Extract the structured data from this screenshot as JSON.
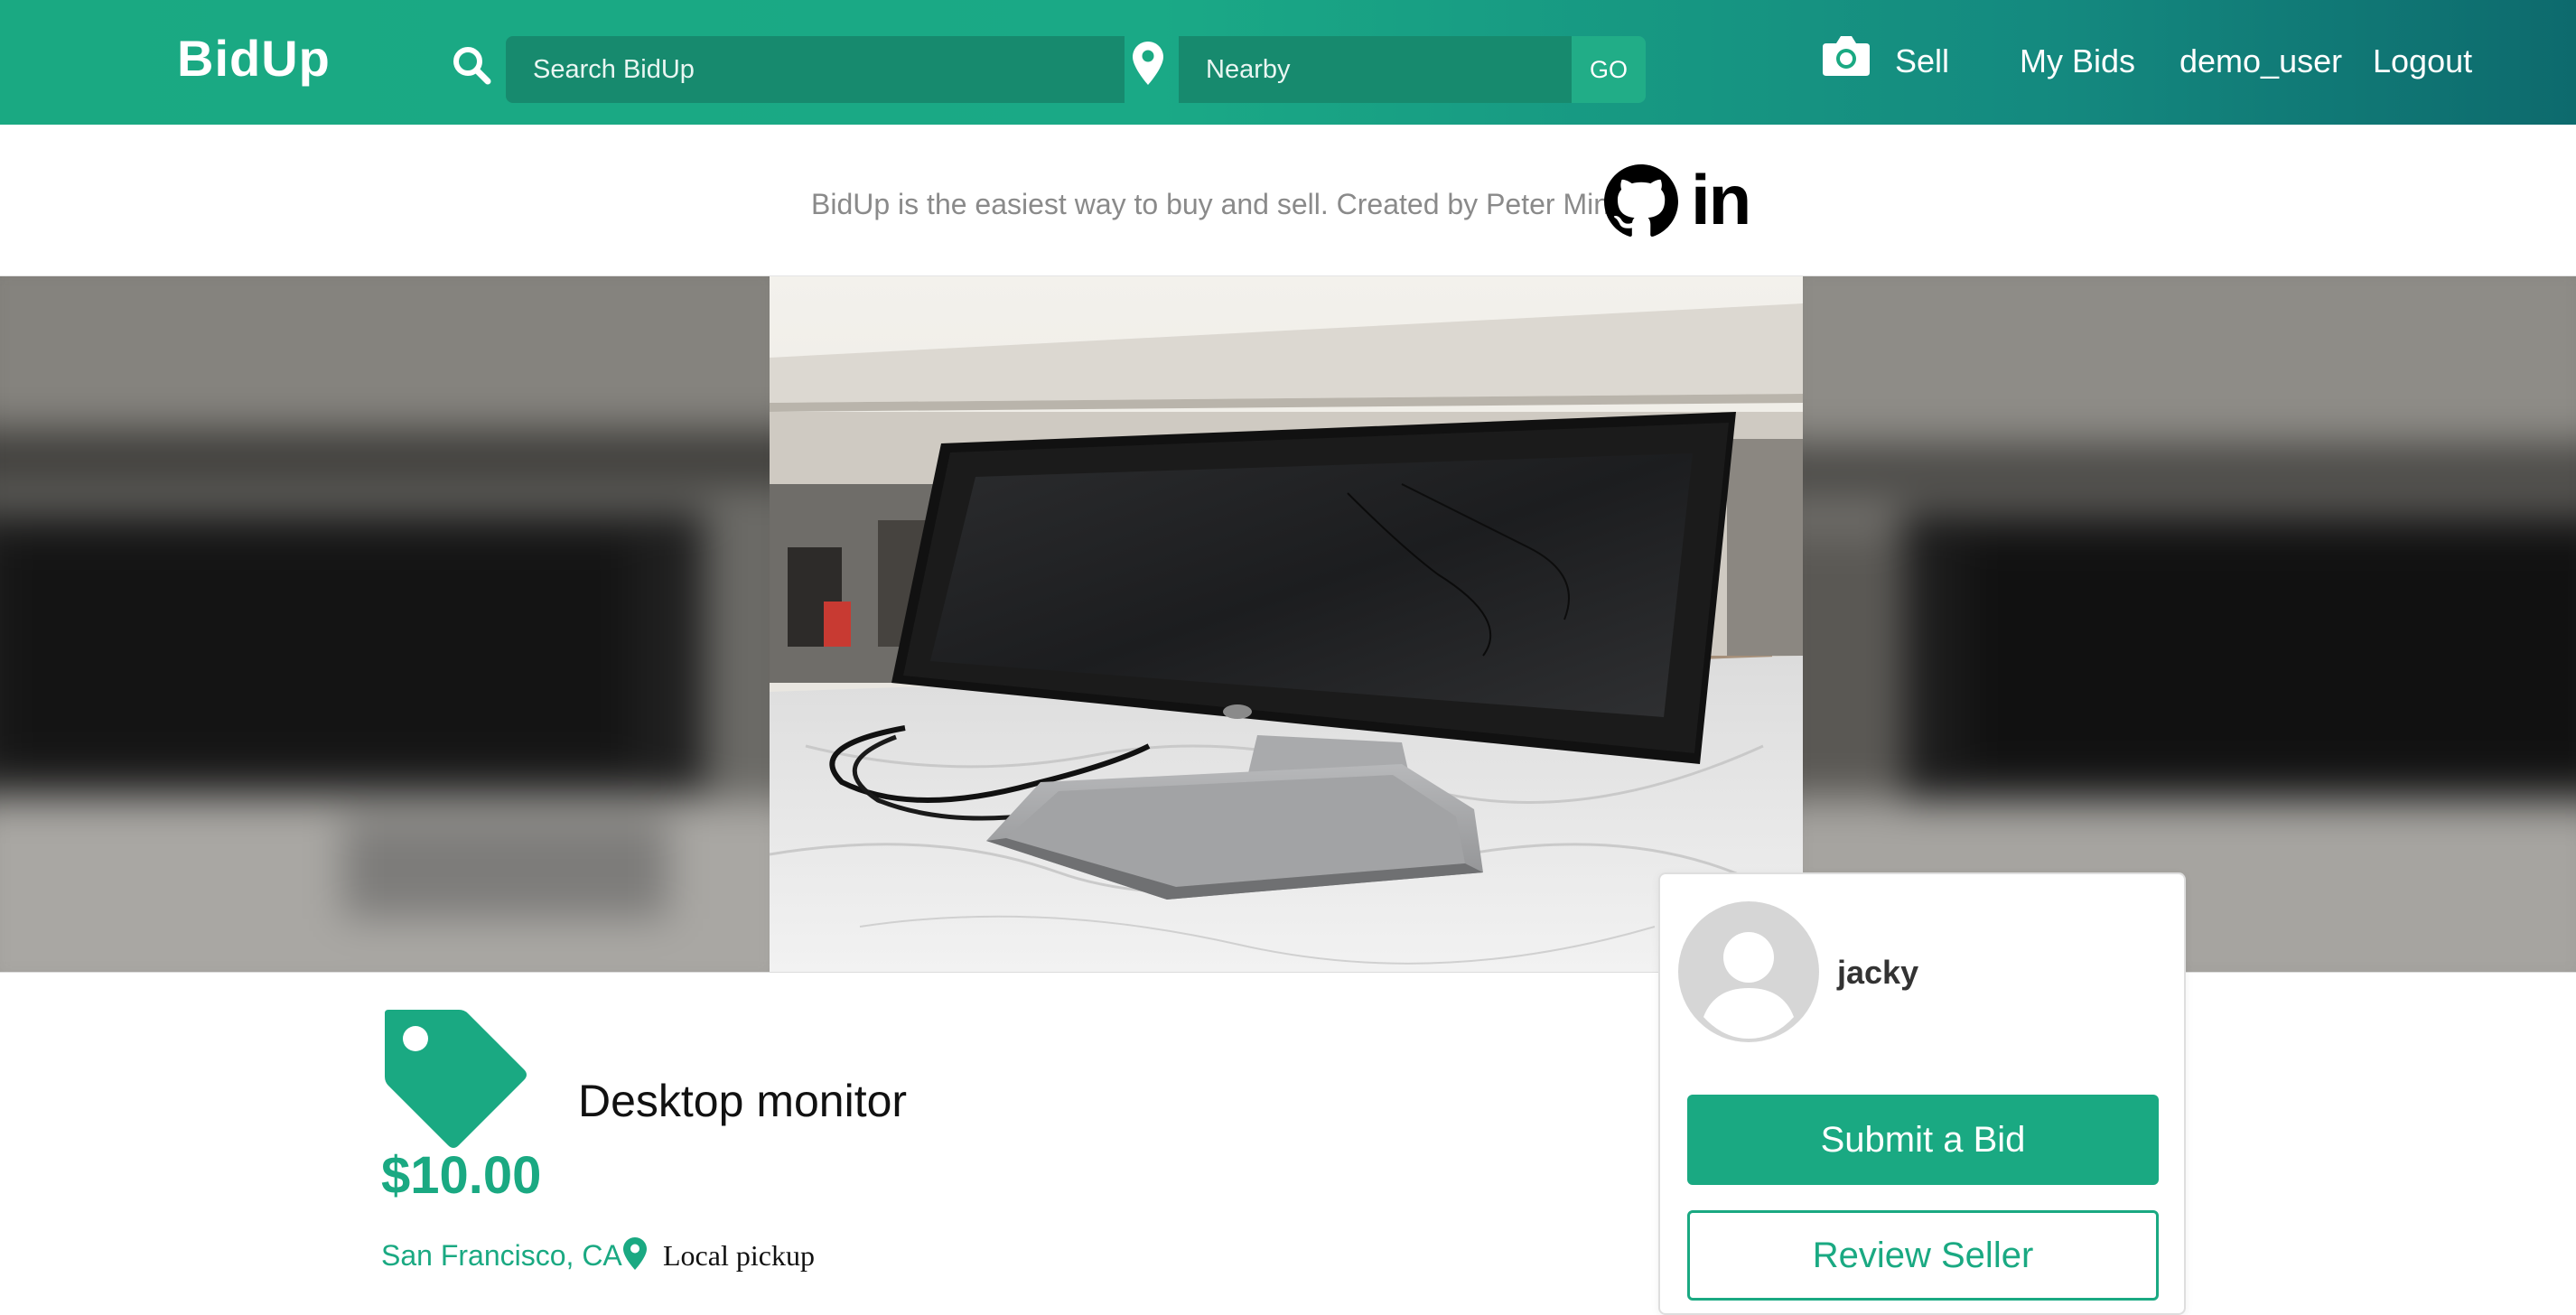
{
  "header": {
    "logo": "BidUp",
    "search_placeholder": "Search BidUp",
    "location_placeholder": "Nearby",
    "go_label": "GO",
    "nav": {
      "sell": "Sell",
      "my_bids": "My Bids",
      "username": "demo_user",
      "logout": "Logout"
    }
  },
  "tagline": {
    "text": "BidUp is the easiest way to buy and sell. Created by Peter Min.",
    "linkedin_glyph": "in"
  },
  "listing": {
    "title": "Desktop monitor",
    "price": "$10.00",
    "location": "San Francisco, CA",
    "pickup": "Local pickup"
  },
  "seller": {
    "name": "jacky",
    "submit_bid_label": "Submit a Bid",
    "review_seller_label": "Review Seller"
  },
  "colors": {
    "brand": "#1aa982",
    "header_dark": "#0d6a6d",
    "input_bg": "#178a6e"
  },
  "icons": [
    "search-icon",
    "map-pin-icon",
    "camera-icon",
    "github-icon",
    "linkedin-icon",
    "price-tag-icon",
    "user-avatar-icon"
  ]
}
